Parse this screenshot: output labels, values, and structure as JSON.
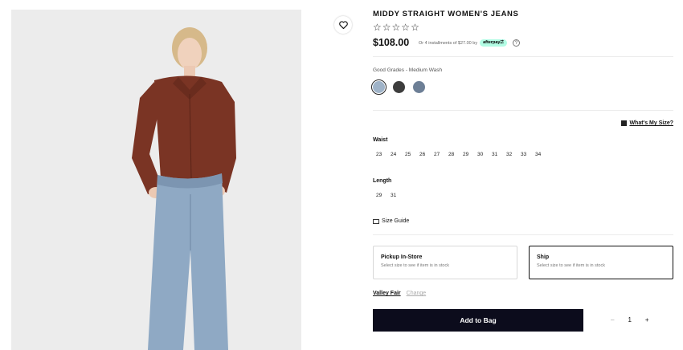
{
  "product": {
    "title": "MIDDY STRAIGHT WOMEN'S JEANS",
    "rating_stars": [
      "☆",
      "☆",
      "☆",
      "☆",
      "☆"
    ],
    "price": "$108.00",
    "afterpay_text": "Or 4 installments of $27.00 by",
    "afterpay_brand": "afterpay⮂",
    "info_symbol": "?"
  },
  "color": {
    "name": "Good Grades - Medium Wash",
    "swatches": [
      "#9fb3c8",
      "#3d3d3d",
      "#6d7f96"
    ]
  },
  "sizing": {
    "whats_my_size": "What's My Size?",
    "waist_label": "Waist",
    "waist": [
      "23",
      "24",
      "25",
      "26",
      "27",
      "28",
      "29",
      "30",
      "31",
      "32",
      "33",
      "34"
    ],
    "length_label": "Length",
    "length": [
      "29",
      "31"
    ],
    "size_guide": "Size Guide"
  },
  "fulfillment": {
    "pickup_title": "Pickup In-Store",
    "pickup_sub": "Select size to see if item is in stock",
    "ship_title": "Ship",
    "ship_sub": "Select size to see if item is in stock",
    "store_name": "Valley Fair",
    "change_label": "Change"
  },
  "cart": {
    "add_label": "Add to Bag",
    "minus": "–",
    "quantity": "1",
    "plus": "+"
  },
  "colors": {
    "shirt": "#7a3424",
    "jeans": "#8fa9c4",
    "button": "#0c0c1c"
  }
}
